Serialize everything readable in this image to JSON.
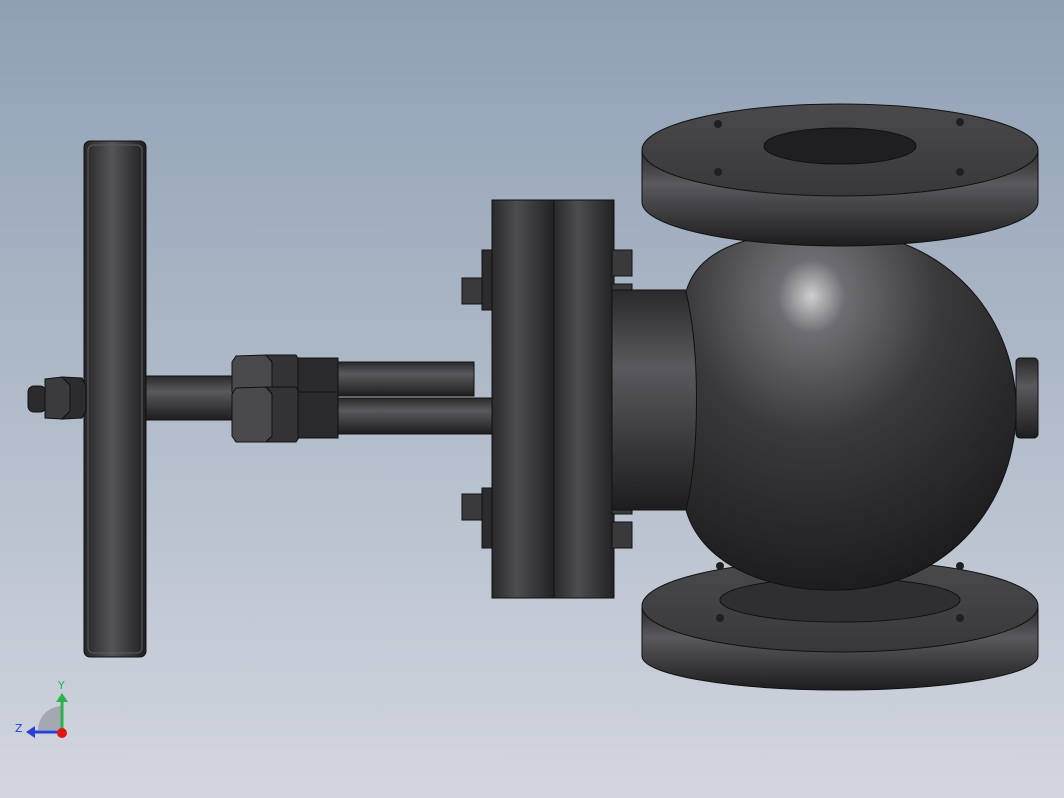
{
  "viewport": {
    "background_top": "#8fa0b4",
    "background_bottom": "#d2d6df",
    "part_color": "#3a3a3c"
  },
  "triad": {
    "y_label": "Y",
    "z_label": "Z",
    "y_color": "#2bb24c",
    "z_color": "#2a3fd6",
    "x_color": "#e01515"
  }
}
